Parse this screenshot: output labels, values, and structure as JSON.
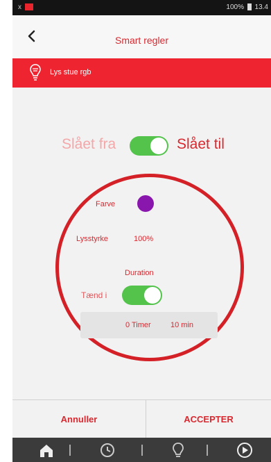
{
  "status_bar": {
    "left_text": "x",
    "right_text": "100%",
    "time": "13.4"
  },
  "header": {
    "title": "Smart regler"
  },
  "device": {
    "name": "Lys stue rgb"
  },
  "power_toggle": {
    "off_label": "Slået fra",
    "on_label": "Slået til",
    "state": "on"
  },
  "settings": {
    "color_label": "Farve",
    "color_value": "#8a17ad",
    "brightness_label": "Lysstyrke",
    "brightness_value": "100%",
    "duration_label": "Duration",
    "turn_on_label": "Tænd i",
    "turn_on_state": "on",
    "hours_value": "0 Timer",
    "minutes_value": "10 min"
  },
  "actions": {
    "cancel_label": "Annuller",
    "accept_label": "ACCEPTER"
  },
  "bottom_nav": [
    "home-icon",
    "clock-icon",
    "bulb-icon",
    "play-icon"
  ],
  "colors": {
    "accent": "#ee2430",
    "toggle_on": "#53c34c",
    "annotation_circle": "#d42127"
  }
}
